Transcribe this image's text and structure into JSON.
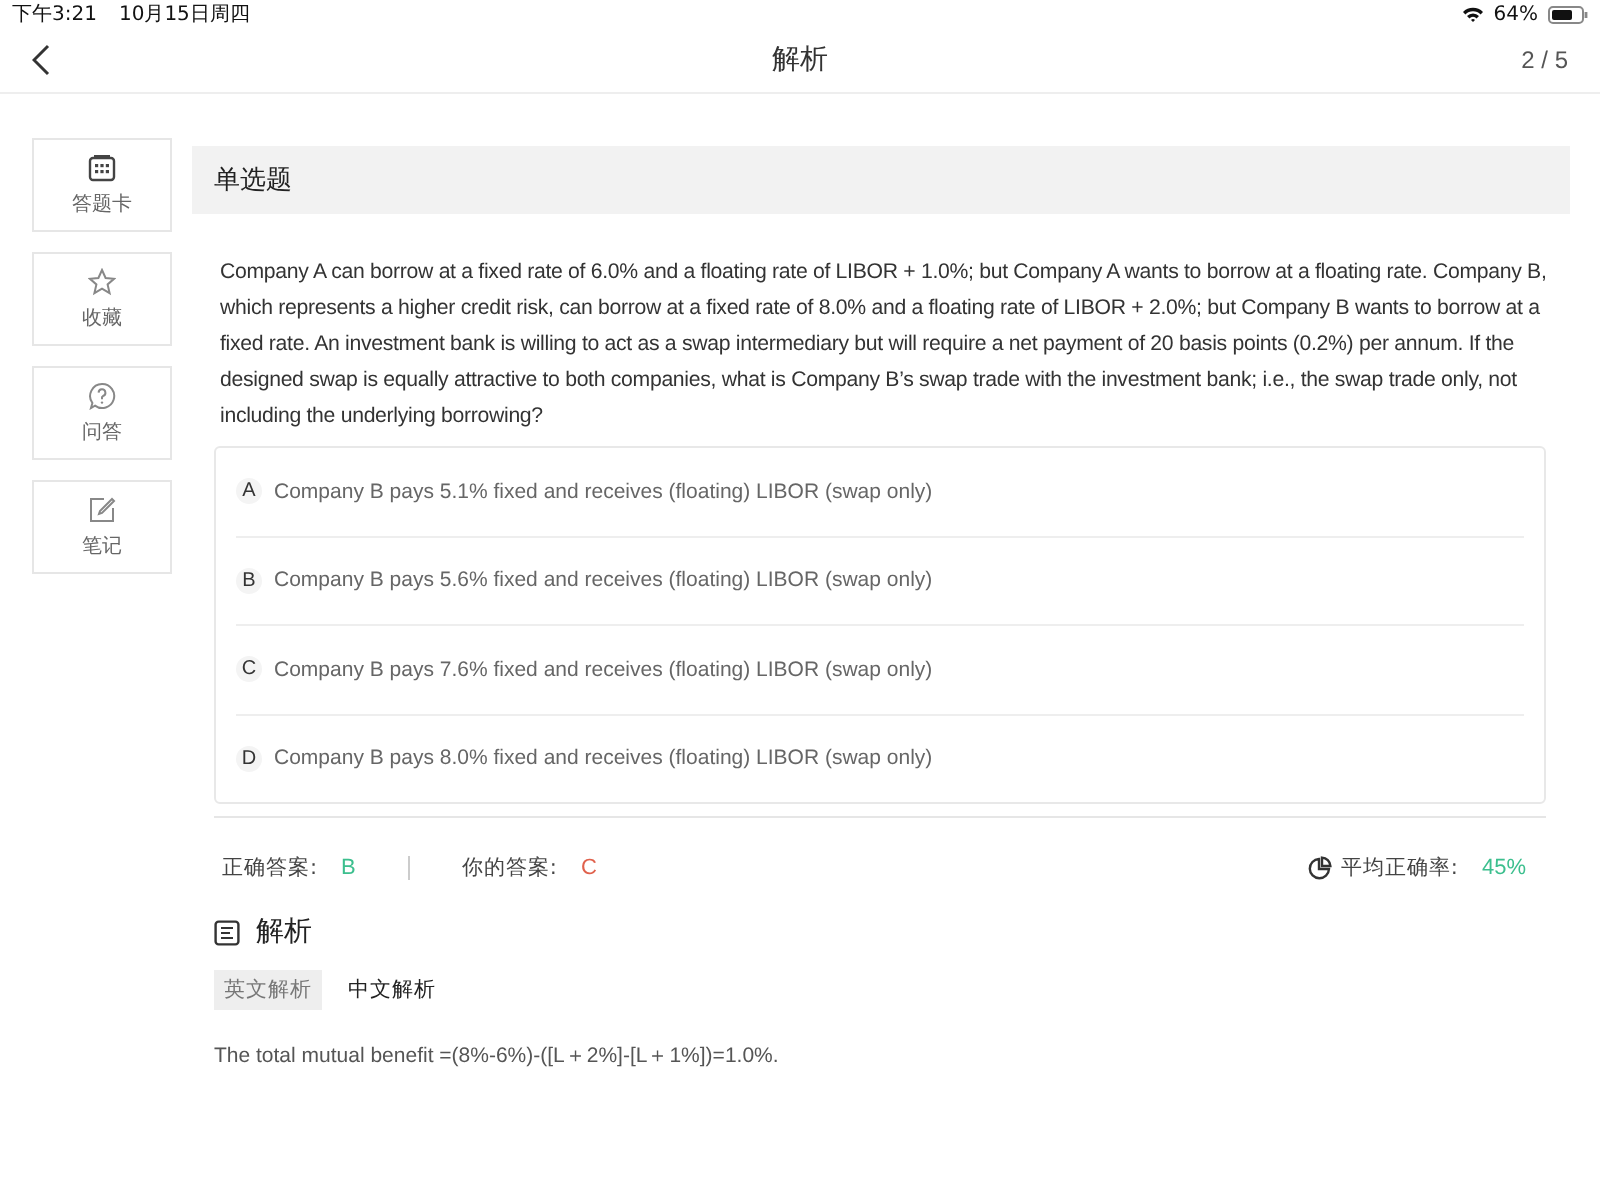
{
  "status_bar": {
    "time": "下午3:21",
    "date": "10月15日周四",
    "battery": "64%"
  },
  "header": {
    "title": "解析",
    "progress": "2 / 5"
  },
  "sidebar": {
    "items": [
      {
        "kind": "card",
        "label": "答题卡"
      },
      {
        "kind": "star",
        "label": "收藏"
      },
      {
        "kind": "question",
        "label": "问答"
      },
      {
        "kind": "note",
        "label": "笔记"
      }
    ]
  },
  "question": {
    "type": "单选题",
    "text": "Company A can borrow at a fixed rate of 6.0% and a floating rate of LIBOR + 1.0%; but Company A wants to borrow at a floating rate. Company B, which represents a higher credit risk, can borrow at a fixed rate of 8.0% and a floating rate of LIBOR + 2.0%; but Company B wants to borrow at a fixed rate. An investment bank is willing to act as a swap intermediary but will require a net payment of 20 basis points (0.2%) per annum. If the designed swap is equally attractive to both companies, what is Company B’s swap trade with the investment bank; i.e., the swap trade only, not including the underlying borrowing?",
    "options": [
      {
        "letter": "A",
        "text": "Company B pays 5.1% fixed and receives (floating) LIBOR (swap only)"
      },
      {
        "letter": "B",
        "text": "Company B pays 5.6% fixed and receives (floating) LIBOR (swap only)"
      },
      {
        "letter": "C",
        "text": "Company B pays 7.6% fixed and receives (floating) LIBOR (swap only)"
      },
      {
        "letter": "D",
        "text": "Company B pays 8.0% fixed and receives (floating) LIBOR (swap only)"
      }
    ]
  },
  "answers": [
    {
      "kind": "correct",
      "label": "正确答案:",
      "value": "B"
    },
    {
      "kind": "yours",
      "label": "你的答案:",
      "value": "C"
    }
  ],
  "accuracy": {
    "label": "平均正确率:",
    "value": "45%"
  },
  "analysis": {
    "heading": "解析",
    "tabs": [
      {
        "label": "英文解析",
        "selected": true
      },
      {
        "label": "中文解析",
        "selected": false
      }
    ],
    "text": "The total mutual benefit =(8%-6%)-([L＋2%]-[L＋1%])=1.0%."
  }
}
